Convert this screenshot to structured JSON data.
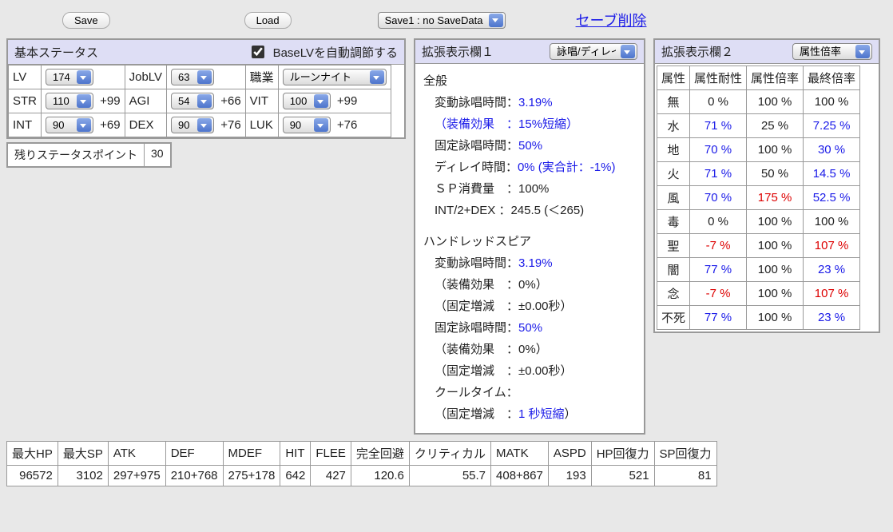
{
  "toolbar": {
    "save": "Save",
    "load": "Load",
    "save_slot": "Save1 : no SaveData",
    "delete_link": "セーブ削除"
  },
  "base": {
    "title": "基本ステータス",
    "auto_lv_label": "BaseLVを自動調節する",
    "lv_label": "LV",
    "lv": "174",
    "joblv_label": "JobLV",
    "joblv": "63",
    "job_label": "職業",
    "job": "ルーンナイト",
    "str_label": "STR",
    "str": "110",
    "str_bonus": "+99",
    "agi_label": "AGI",
    "agi": "54",
    "agi_bonus": "+66",
    "vit_label": "VIT",
    "vit": "100",
    "vit_bonus": "+99",
    "int_label": "INT",
    "int": "90",
    "int_bonus": "+69",
    "dex_label": "DEX",
    "dex": "90",
    "dex_bonus": "+76",
    "luk_label": "LUK",
    "luk": "90",
    "luk_bonus": "+76",
    "remain_label": "残りステータスポイント",
    "remain": "30"
  },
  "ext1": {
    "title": "拡張表示欄１",
    "mode": "詠唱/ディレイ",
    "general": "全般",
    "vcast_label": "変動詠唱時間：",
    "vcast": "3.19%",
    "equip_label": "（装備効果　：",
    "equip": "15%短縮",
    "equip_close": "）",
    "fcast_label": "固定詠唱時間：",
    "fcast": "50%",
    "delay_label": "ディレイ時間：",
    "delay": "0% (実合計：-1%)",
    "sp_label": "ＳＰ消費量　：",
    "sp": "100%",
    "intdex_label": "INT/2+DEX ：",
    "intdex": "245.5 (＜265)",
    "skill_name": "ハンドレッドスピア",
    "s_vcast_label": "変動詠唱時間：",
    "s_vcast": "3.19%",
    "s_equip_label": "（装備効果　：",
    "s_equip": "0%",
    "s_equip_close": "）",
    "s_fix_label": "（固定増減　：",
    "s_fix": "±0.00秒",
    "s_fix_close": "）",
    "s_fcast_label": "固定詠唱時間：",
    "s_fcast": "50%",
    "s_equip2_label": "（装備効果　：",
    "s_equip2": "0%",
    "s_equip2_close": "）",
    "s_fix2_label": "（固定増減　：",
    "s_fix2": "±0.00秒",
    "s_fix2_close": "）",
    "s_cool_label": "クールタイム：",
    "s_cool_fix_label": "（固定増減　：",
    "s_cool_fix": "1 秒短縮",
    "s_cool_fix_close": "）"
  },
  "ext2": {
    "title": "拡張表示欄２",
    "mode": "属性倍率",
    "headers": [
      "属性",
      "属性耐性",
      "属性倍率",
      "最終倍率"
    ],
    "rows": [
      {
        "n": "無",
        "r": "0 %",
        "m": "100 %",
        "f": "100 %",
        "rc": "",
        "fc": ""
      },
      {
        "n": "水",
        "r": "71 %",
        "m": "25 %",
        "f": "7.25 %",
        "rc": "blue",
        "fc": "blue"
      },
      {
        "n": "地",
        "r": "70 %",
        "m": "100 %",
        "f": "30 %",
        "rc": "blue",
        "fc": "blue"
      },
      {
        "n": "火",
        "r": "71 %",
        "m": "50 %",
        "f": "14.5 %",
        "rc": "blue",
        "fc": "blue"
      },
      {
        "n": "風",
        "r": "70 %",
        "m": "175 %",
        "f": "52.5 %",
        "rc": "blue",
        "mc": "red",
        "fc": "blue"
      },
      {
        "n": "毒",
        "r": "0 %",
        "m": "100 %",
        "f": "100 %",
        "rc": "",
        "fc": ""
      },
      {
        "n": "聖",
        "r": "-7 %",
        "m": "100 %",
        "f": "107 %",
        "rc": "red",
        "fc": "red"
      },
      {
        "n": "闇",
        "r": "77 %",
        "m": "100 %",
        "f": "23 %",
        "rc": "blue",
        "fc": "blue"
      },
      {
        "n": "念",
        "r": "-7 %",
        "m": "100 %",
        "f": "107 %",
        "rc": "red",
        "fc": "red"
      },
      {
        "n": "不死",
        "r": "77 %",
        "m": "100 %",
        "f": "23 %",
        "rc": "blue",
        "fc": "blue"
      }
    ]
  },
  "footer": {
    "headers": [
      "最大HP",
      "最大SP",
      "ATK",
      "DEF",
      "MDEF",
      "HIT",
      "FLEE",
      "完全回避",
      "クリティカル",
      "MATK",
      "ASPD",
      "HP回復力",
      "SP回復力"
    ],
    "values": [
      "96572",
      "3102",
      "297+975",
      "210+768",
      "275+178",
      "642",
      "427",
      "120.6",
      "55.7",
      "408+867",
      "193",
      "521",
      "81"
    ]
  }
}
